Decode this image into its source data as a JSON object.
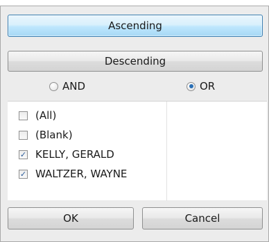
{
  "sort": {
    "ascending_label": "Ascending",
    "descending_label": "Descending"
  },
  "logic": {
    "and_label": "AND",
    "or_label": "OR",
    "selected": "OR"
  },
  "filter_values": [
    {
      "label": "(All)",
      "checked": false
    },
    {
      "label": "(Blank)",
      "checked": false
    },
    {
      "label": "KELLY, GERALD",
      "checked": true
    },
    {
      "label": "WALTZER, WAYNE",
      "checked": true
    }
  ],
  "actions": {
    "ok_label": "OK",
    "cancel_label": "Cancel"
  },
  "colors": {
    "selected_button": "#bee6fd",
    "radio_dot": "#2a6fb5",
    "check_mark": "#2b5c9a"
  }
}
